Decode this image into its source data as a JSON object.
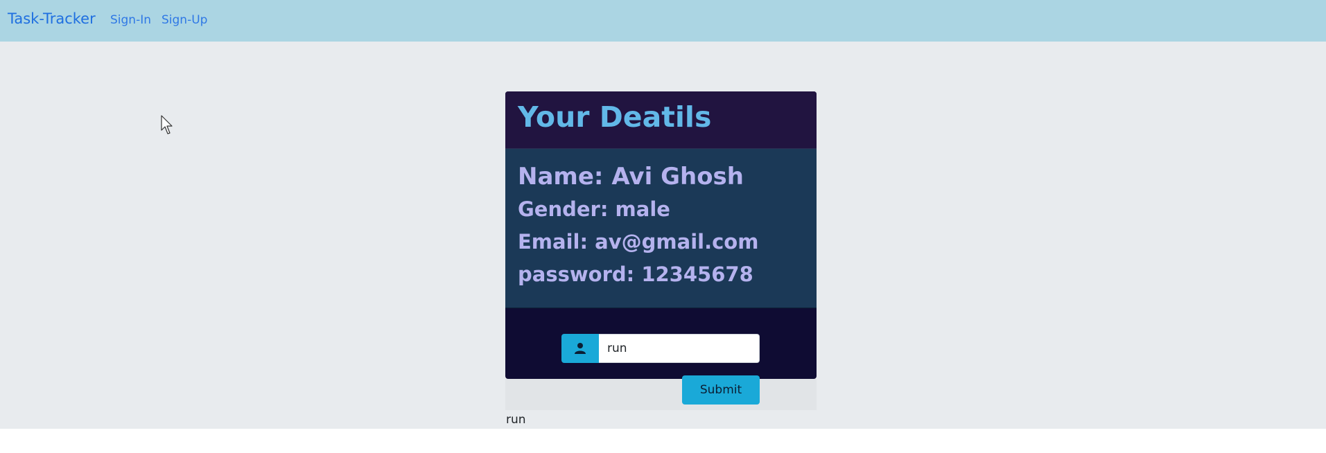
{
  "navbar": {
    "brand": "Task-Tracker",
    "links": [
      "Sign-In",
      "Sign-Up"
    ]
  },
  "card": {
    "title": "Your Deatils",
    "details": {
      "name": "Name: Avi Ghosh",
      "gender": "Gender: male",
      "email": "Email: av@gmail.com",
      "password": "password: 12345678"
    },
    "input": {
      "icon": "user-icon",
      "value": "run"
    },
    "submit_label": "Submit"
  },
  "output": "run",
  "colors": {
    "navbar_bg": "#abd5e3",
    "link": "#2f78e5",
    "card_header_bg": "#211440",
    "card_title": "#62b8e8",
    "card_body_bg": "#1b3957",
    "detail_text": "#b5b2ee",
    "card_footer_bg": "#0f0c33",
    "accent": "#1aa9d8"
  }
}
